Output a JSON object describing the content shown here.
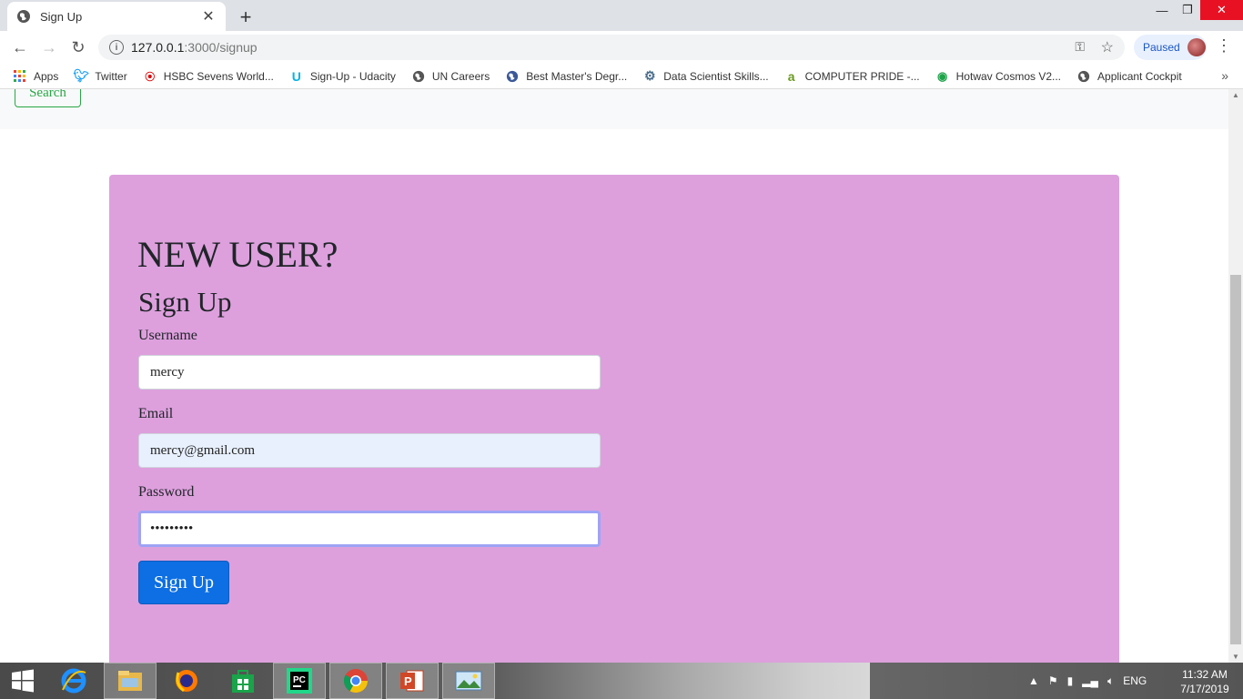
{
  "browser": {
    "tab_title": "Sign Up",
    "url_host": "127.0.0.1",
    "url_path": ":3000/signup",
    "profile_label": "Paused"
  },
  "bookmarks": [
    {
      "label": "Apps",
      "icon": "apps-grid-icon"
    },
    {
      "label": "Twitter",
      "icon": "twitter-bird-icon"
    },
    {
      "label": "HSBC Sevens World...",
      "icon": "hsbc-icon"
    },
    {
      "label": "Sign-Up - Udacity",
      "icon": "udacity-icon"
    },
    {
      "label": "UN Careers",
      "icon": "globe-icon"
    },
    {
      "label": "Best Master's Degr...",
      "icon": "globe-icon"
    },
    {
      "label": "Data Scientist Skills...",
      "icon": "gear-icon"
    },
    {
      "label": "COMPUTER PRIDE -...",
      "icon": "computer-pride-icon"
    },
    {
      "label": "Hotwav Cosmos V2...",
      "icon": "hotwav-icon"
    },
    {
      "label": "Applicant Cockpit",
      "icon": "globe-icon"
    }
  ],
  "page": {
    "nav_search_label": "Search",
    "heading": "NEW USER?",
    "subheading": "Sign Up",
    "username_label": "Username",
    "username_value": "mercy",
    "email_label": "Email",
    "email_value": "mercy@gmail.com",
    "password_label": "Password",
    "password_value": "•••••••••",
    "submit_label": "Sign Up"
  },
  "taskbar": {
    "language": "ENG",
    "time": "11:32 AM",
    "date": "7/17/2019"
  },
  "colors": {
    "card_bg": "#dda0dd",
    "submit_bg": "#0d6fe3",
    "search_outline": "#28a745"
  }
}
